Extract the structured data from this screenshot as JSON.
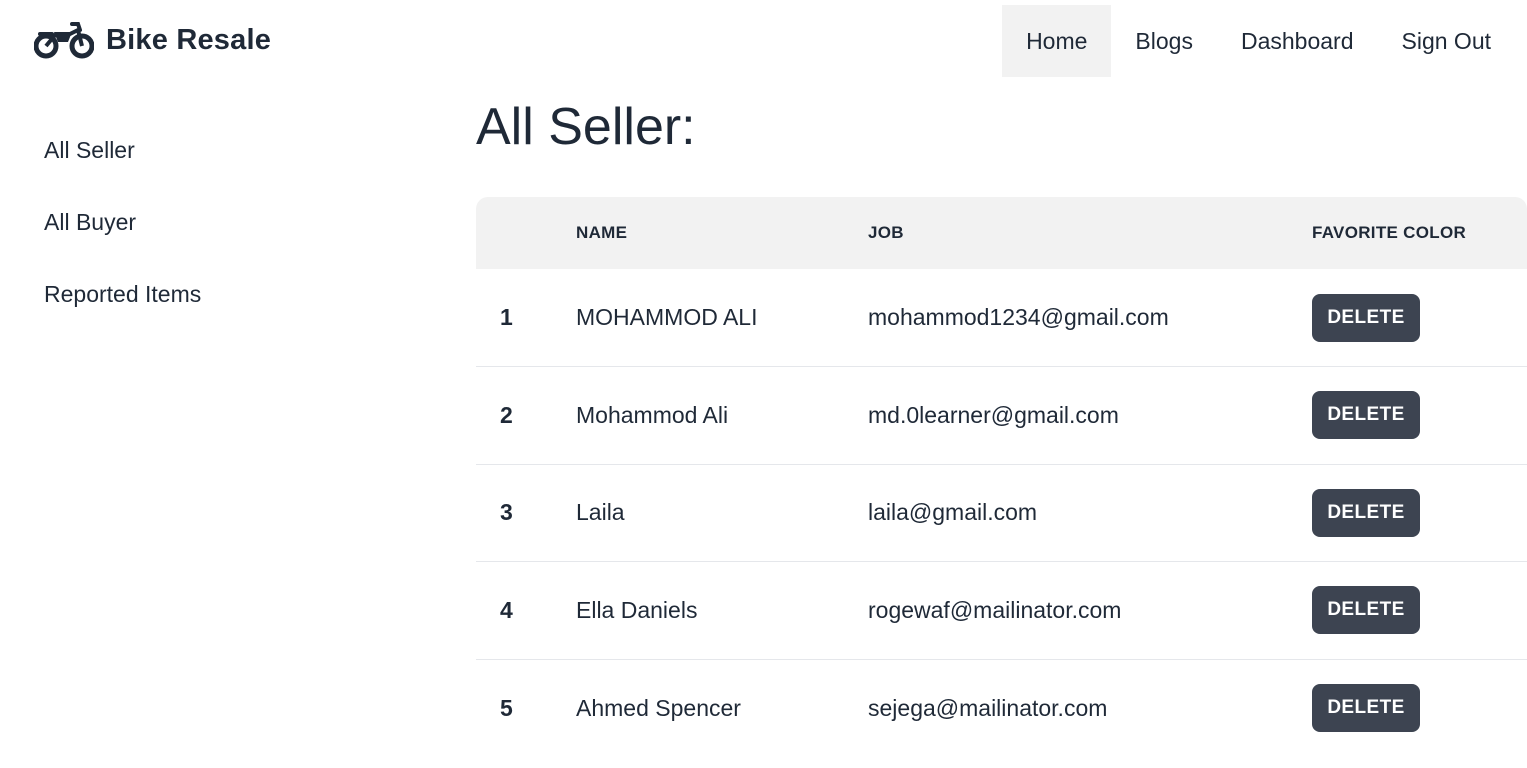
{
  "brand": {
    "name": "Bike Resale",
    "icon": "motorcycle-icon"
  },
  "nav": {
    "links": [
      {
        "label": "Home"
      },
      {
        "label": "Blogs"
      },
      {
        "label": "Dashboard"
      },
      {
        "label": "Sign Out"
      }
    ]
  },
  "sidebar": {
    "items": [
      {
        "label": "All Seller"
      },
      {
        "label": "All Buyer"
      },
      {
        "label": "Reported Items"
      }
    ]
  },
  "main": {
    "title": "All Seller:",
    "table": {
      "headers": [
        "",
        "NAME",
        "JOB",
        "FAVORITE COLOR"
      ],
      "rows": [
        {
          "index": "1",
          "name": "MOHAMMOD ALI",
          "job": "mohammod1234@gmail.com",
          "action": "DELETE"
        },
        {
          "index": "2",
          "name": "Mohammod Ali",
          "job": "md.0learner@gmail.com",
          "action": "DELETE"
        },
        {
          "index": "3",
          "name": "Laila",
          "job": "laila@gmail.com",
          "action": "DELETE"
        },
        {
          "index": "4",
          "name": "Ella Daniels",
          "job": "rogewaf@mailinator.com",
          "action": "DELETE"
        },
        {
          "index": "5",
          "name": "Ahmed Spencer",
          "job": "sejega@mailinator.com",
          "action": "DELETE"
        }
      ]
    }
  },
  "colors": {
    "text": "#1f2937",
    "button_bg": "#3d4451",
    "header_bg": "#f2f2f2"
  }
}
